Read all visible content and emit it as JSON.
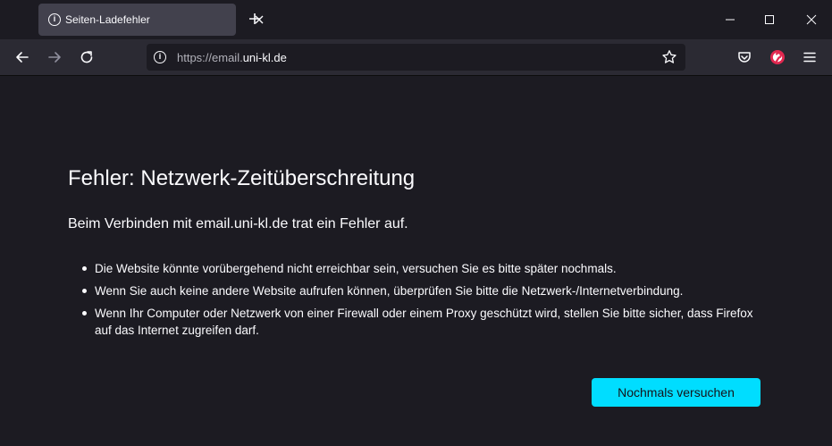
{
  "tab": {
    "title": "Seiten-Ladefehler",
    "icon": "info-icon"
  },
  "urlbar": {
    "scheme": "https://email.",
    "host": "uni-kl.de"
  },
  "error": {
    "title": "Fehler: Netzwerk-Zeitüberschreitung",
    "subtitle": "Beim Verbinden mit email.uni-kl.de trat ein Fehler auf.",
    "items": [
      "Die Website könnte vorübergehend nicht erreichbar sein, versuchen Sie es bitte später nochmals.",
      "Wenn Sie auch keine andere Website aufrufen können, überprüfen Sie bitte die Netzwerk-/Internetverbindung.",
      "Wenn Ihr Computer oder Netzwerk von einer Firewall oder einem Proxy geschützt wird, stellen Sie bitte sicher, dass Firefox auf das Internet zugreifen darf."
    ],
    "retry_label": "Nochmals versuchen"
  },
  "colors": {
    "accent": "#00ddff",
    "background": "#1c1b22",
    "toolbar": "#2b2a33",
    "tab": "#42414d"
  }
}
